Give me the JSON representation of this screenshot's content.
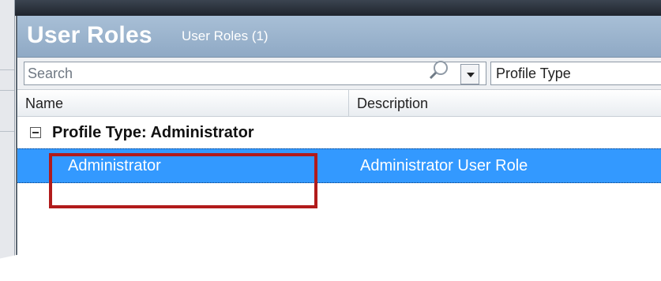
{
  "header": {
    "title": "User Roles",
    "subtitle": "User Roles (1)"
  },
  "toolbar": {
    "search_placeholder": "Search",
    "profile_filter_value": "Profile Type"
  },
  "table": {
    "columns": [
      "Name",
      "Description"
    ],
    "group_label": "Profile Type: Administrator",
    "rows": [
      {
        "name": "Administrator",
        "description": "Administrator User Role",
        "selected": true
      }
    ]
  },
  "colors": {
    "header_bg": "#9ab3cc",
    "selection": "#3399ff",
    "annotation_box": "#b11b1b"
  },
  "icons": {
    "search": "magnifier-icon",
    "dropdown": "chevron-down-icon",
    "group_toggle": "collapse-minus-icon"
  }
}
